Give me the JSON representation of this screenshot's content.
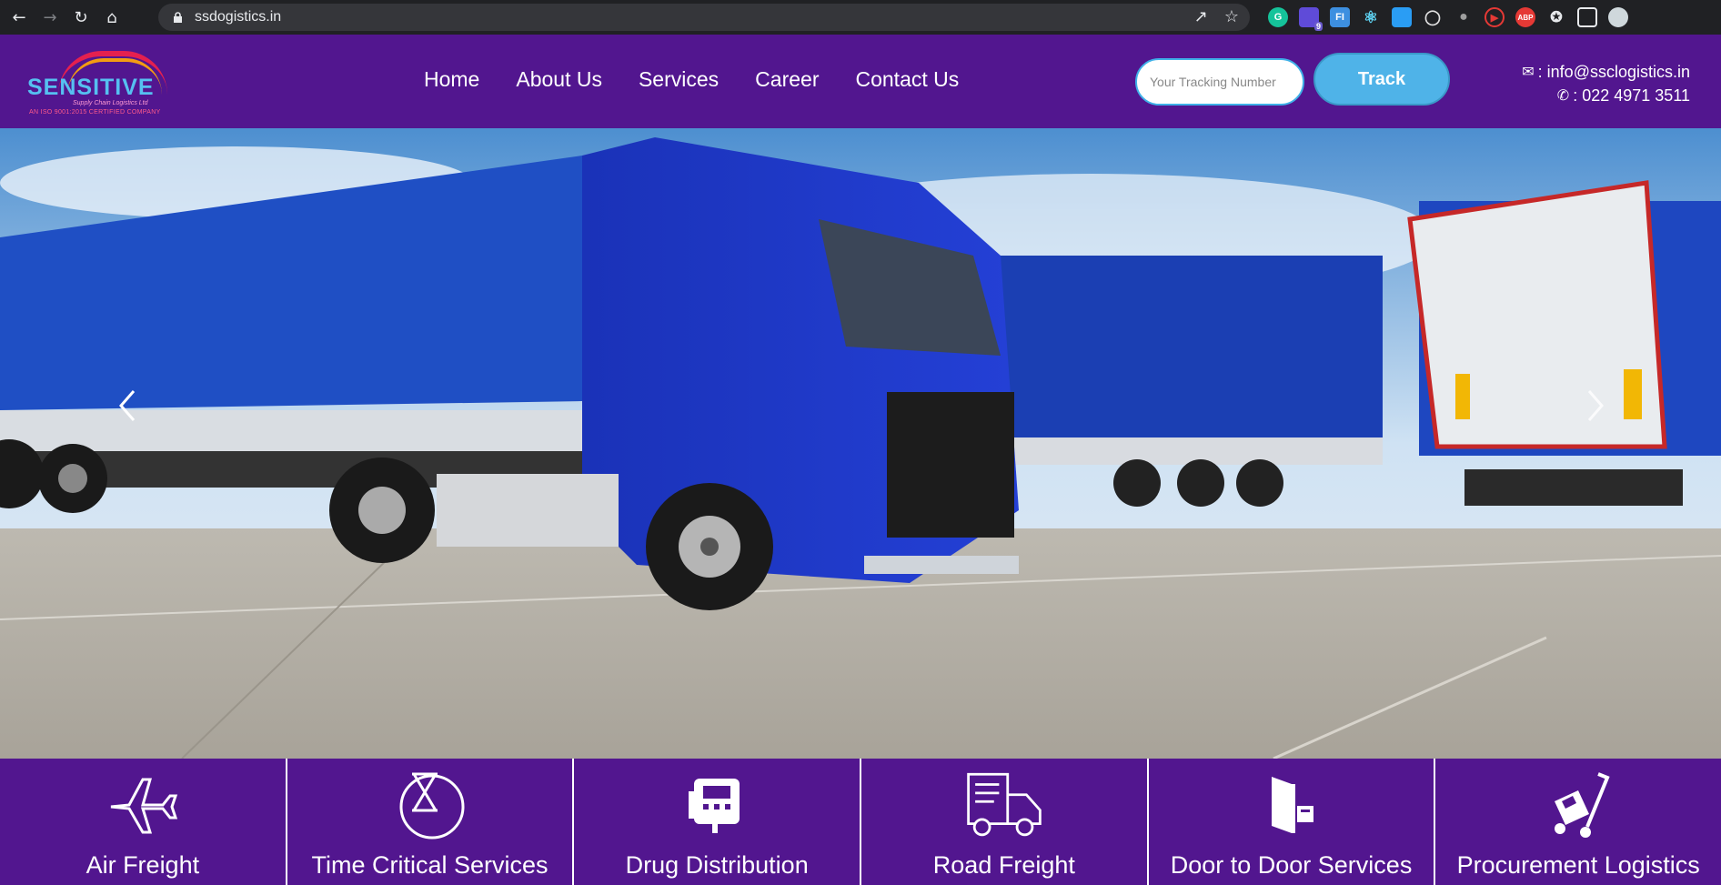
{
  "browser": {
    "url": "ssdogistics.in",
    "back_icon": "arrow-left-icon",
    "forward_icon": "arrow-right-icon",
    "reload_icon": "reload-icon",
    "home_icon": "home-icon",
    "ext_badge": "9",
    "ext_fi": "FI",
    "ext_abp": "ABP"
  },
  "logo": {
    "name": "SENSITIVE",
    "tagline": "Supply Chain Logistics Ltd",
    "certification": "AN ISO 9001:2015 CERTIFIED COMPANY"
  },
  "nav": {
    "items": [
      "Home",
      "About Us",
      "Services",
      "Career",
      "Contact Us"
    ]
  },
  "tracking": {
    "placeholder": "Your Tracking Number",
    "button": "Track"
  },
  "contact": {
    "email": ": info@ssclogistics.in",
    "phone": ": 022 4971 3511"
  },
  "services": [
    {
      "label": "Air Freight",
      "icon": "airplane-icon"
    },
    {
      "label": "Time Critical Services",
      "icon": "hourglass-head-icon"
    },
    {
      "label": "Drug Distribution",
      "icon": "drug-device-icon"
    },
    {
      "label": "Road Freight",
      "icon": "truck-icon"
    },
    {
      "label": "Door to Door Services",
      "icon": "door-icon"
    },
    {
      "label": "Procurement Logistics",
      "icon": "hand-trolley-icon"
    }
  ],
  "colors": {
    "header_bg": "#52168f",
    "accent": "#4fb3e8",
    "browser_bg": "#202124"
  }
}
